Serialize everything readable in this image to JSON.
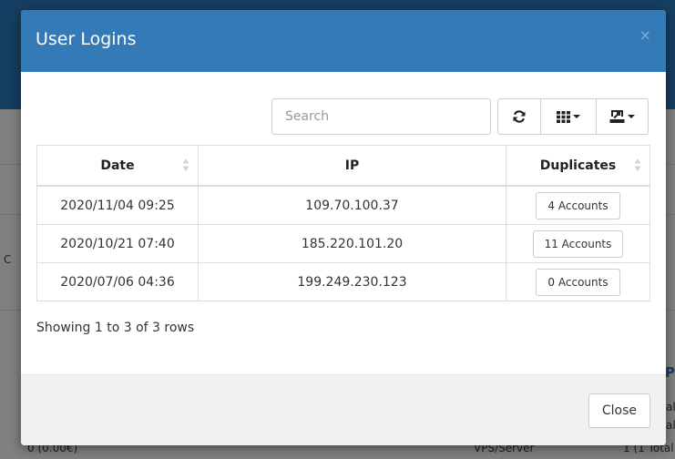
{
  "background": {
    "left_text_1": "C",
    "left_text_2": "0 (0.00€)",
    "right_text_1": "VPS/Server",
    "right_text_2": "1 (1 Total",
    "right_text_3": "Pr",
    "right_text_4": "al",
    "right_text_5": "al"
  },
  "modal": {
    "title": "User Logins",
    "close_x": "×",
    "search": {
      "placeholder": "Search",
      "value": ""
    },
    "toolbar": {
      "refresh_icon": "refresh-icon",
      "columns_icon": "columns-icon",
      "export_icon": "export-icon"
    },
    "table": {
      "columns": [
        "Date",
        "IP",
        "Duplicates"
      ],
      "rows": [
        {
          "date": "2020/11/04 09:25",
          "ip": "109.70.100.37",
          "duplicates": "4 Accounts"
        },
        {
          "date": "2020/10/21 07:40",
          "ip": "185.220.101.20",
          "duplicates": "11 Accounts"
        },
        {
          "date": "2020/07/06 04:36",
          "ip": "199.249.230.123",
          "duplicates": "0 Accounts"
        }
      ]
    },
    "pagination_text": "Showing 1 to 3 of 3 rows",
    "footer": {
      "close_label": "Close"
    }
  },
  "colors": {
    "header": "#337ab7",
    "footer": "#f0f0f0"
  }
}
